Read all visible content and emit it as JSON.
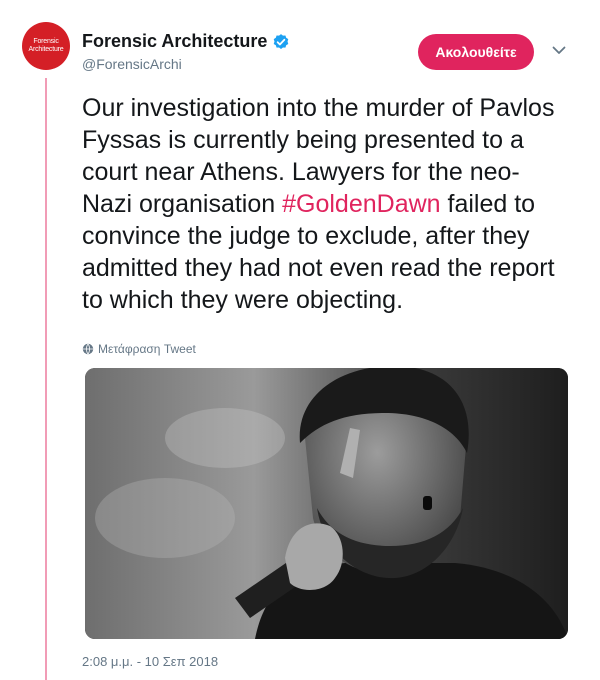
{
  "account": {
    "avatar_lines": [
      "Forensic",
      "Architecture"
    ],
    "name": "Forensic Architecture",
    "handle": "@ForensicArchi",
    "verified": true,
    "follow_label": "Ακολουθείτε"
  },
  "tweet": {
    "text_before": "Our investigation into the murder of Pavlos Fyssas is currently being presented to a court near Athens. Lawyers for the neo-Nazi organisation ",
    "hashtag": "#GoldenDawn",
    "text_after": " failed to convince the judge to exclude, after they admitted they had not even read the report to which they were objecting.",
    "translate_label": "Μετάφραση Tweet",
    "timestamp": "2:08 μ.μ. - 10 Σεπ 2018"
  },
  "icons": {
    "verified": "verified-badge-icon",
    "caret": "chevron-down-icon",
    "translate": "globe-icon"
  },
  "colors": {
    "accent": "#e0245e",
    "verified": "#1da1f2",
    "avatar_bg": "#d41f26",
    "muted": "#657786"
  }
}
